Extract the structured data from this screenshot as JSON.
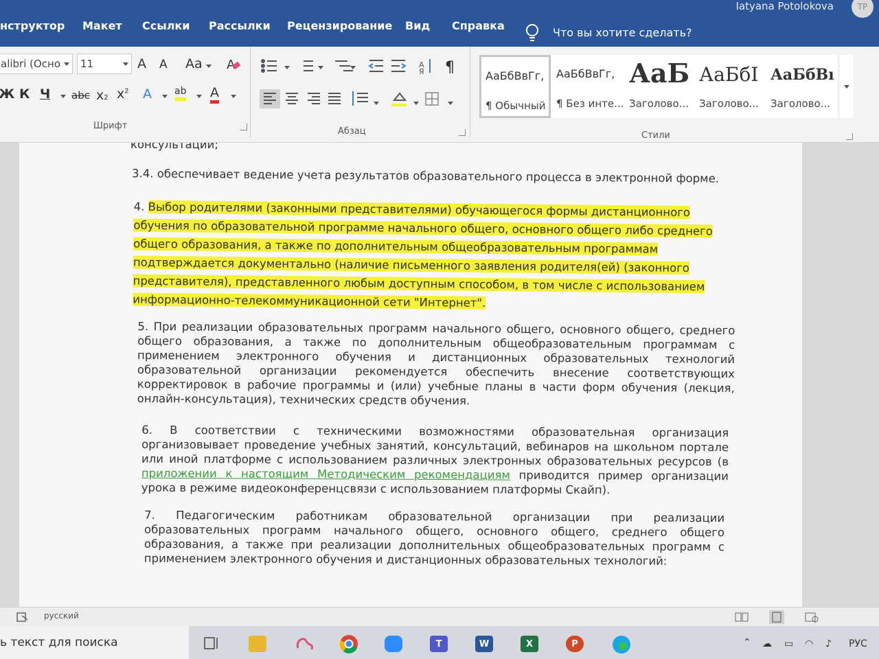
{
  "ribbon_tabs": [
    "нструктор",
    "Макет",
    "Ссылки",
    "Рассылки",
    "Рецензирование",
    "Вид",
    "Справка"
  ],
  "tell_me": "Что вы хотите сделать?",
  "user": {
    "name": "Iatyana Potolokova",
    "initials": "TP"
  },
  "font": {
    "name": "alibri (Осно",
    "size": "11",
    "grow": "A",
    "shrink": "A",
    "case": "Aa",
    "bold": "Ж",
    "italic": "К",
    "underline": "Ч",
    "strike": "abc",
    "sub": "x",
    "sup": "x",
    "effects": "A",
    "highlight": "ab",
    "color": "A",
    "group_label": "Шрифт"
  },
  "paragraph": {
    "pilcrow": "¶",
    "group_label": "Абзац"
  },
  "styles": {
    "group_label": "Стили",
    "items": [
      {
        "sample": "АаБбВвГг,",
        "name": "¶ Обычный"
      },
      {
        "sample": "АаБбВвГг,",
        "name": "¶ Без инте..."
      },
      {
        "sample": "АаБ",
        "name": "Заголово..."
      },
      {
        "sample": "АаБбІ",
        "name": "Заголово..."
      },
      {
        "sample": "АаБбВı",
        "name": "Заголово..."
      }
    ]
  },
  "document": {
    "p0": "консультаций;",
    "p1": "3.4. обеспечивает ведение учета результатов образовательного процесса в электронной форме.",
    "p2_num": "4. ",
    "p2": "Выбор родителями (законными представителями) обучающегося формы дистанционного обучения по образовательной программе начального общего, основного общего либо среднего общего образования, а также по дополнительным общеобразовательным программам подтверждается документально (наличие письменного заявления родителя(ей) (законного представителя), представленного любым доступным способом, в том числе с использованием информационно-телекоммуникационной сети \"Интернет\".",
    "p3": "5. При реализации образовательных программ начального общего, основного общего, среднего общего образования, а также по дополнительным общеобразовательным программам с применением электронного обучения и дистанционных образовательных технологий образовательной организации рекомендуется обеспечить внесение соответствующих корректировок в рабочие программы и (или) учебные планы в части форм обучения (лекция, онлайн-консультация), технических средств обучения.",
    "p4_a": "6. В соответствии с техническими возможностями образовательная организация организовывает проведение учебных занятий, консультаций, вебинаров на школьном портале или иной платформе с использованием различных электронных образовательных ресурсов (в ",
    "p4_link": "приложении к настоящим Методическим рекомендациям",
    "p4_b": " приводится пример организации урока в режиме видеоконференцсвязи с использованием платформы Скайп).",
    "p5": "7. Педагогическим работникам образовательной организации при реализации образовательных программ начального общего, основного общего, среднего общего образования, а также при реализации дополнительных общеобразовательных программ с применением электронного обучения и дистанционных образовательных технологий:"
  },
  "status": {
    "language": "русский"
  },
  "taskbar": {
    "search_placeholder": "ь текст для поиска",
    "lang": "РУС",
    "apps": [
      "task-view",
      "file-explorer",
      "paint-3d",
      "chrome",
      "zoom",
      "teams",
      "word",
      "excel",
      "powerpoint",
      "edge"
    ]
  },
  "colors": {
    "title_bar": "#2b579a",
    "highlight": "#f5f03a",
    "link": "#3aa03a"
  }
}
